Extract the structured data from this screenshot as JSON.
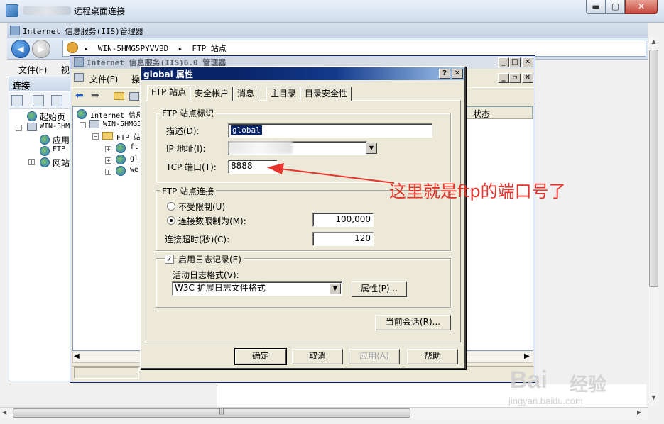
{
  "rdp": {
    "title": "远程桌面连接",
    "buttons": {
      "minimize": "▬",
      "maximize": "▢",
      "close": "✕"
    }
  },
  "iis7": {
    "title": "Internet 信息服务(IIS)管理器",
    "breadcrumb": "▸  WIN-5HMG5PYVVBD  ▸  FTP 站点",
    "menu": {
      "file": "文件(F)",
      "view": "视"
    },
    "connections": {
      "title": "连接",
      "tree": [
        {
          "label": "起始页"
        },
        {
          "label": "WIN-5HM"
        },
        {
          "label": "应用"
        },
        {
          "label": "FTP"
        },
        {
          "label": "网站"
        }
      ]
    }
  },
  "iis6": {
    "title": "Internet 信息服务(IIS)6.0 管理器",
    "menu": {
      "file": "文件(F)",
      "op": "操"
    },
    "tree": [
      {
        "label": "Internet 信息"
      },
      {
        "label": "WIN-5HMG5"
      },
      {
        "label": "FTP 站点"
      },
      {
        "label": "ft"
      },
      {
        "label": "gl"
      },
      {
        "label": "we"
      }
    ],
    "list_header": {
      "status": "状态"
    }
  },
  "dialog": {
    "title": "global 属性",
    "help_btn": "?",
    "close_btn": "✕",
    "tabs": [
      "FTP 站点",
      "安全帐户",
      "消息",
      "主目录",
      "目录安全性"
    ],
    "active_tab": "FTP 站点",
    "group_identity": {
      "label": "FTP 站点标识",
      "desc_label": "描述(D):",
      "desc_value": "global",
      "ip_label": "IP 地址(I):",
      "port_label": "TCP 端口(T):",
      "port_value": "8888"
    },
    "group_connection": {
      "label": "FTP 站点连接",
      "unlimited_label": "不受限制(U)",
      "limited_label": "连接数限制为(M):",
      "limited_selected": true,
      "limit_value": "100,000",
      "timeout_label": "连接超时(秒)(C):",
      "timeout_value": "120"
    },
    "group_logging": {
      "enable_label": "启用日志记录(E)",
      "enabled": true,
      "format_label": "活动日志格式(V):",
      "format_value": "W3C 扩展日志文件格式",
      "properties_button": "属性(P)..."
    },
    "current_sessions_button": "当前会话(R)...",
    "buttons": {
      "ok": "确定",
      "cancel": "取消",
      "apply": "应用(A)",
      "help": "帮助"
    }
  },
  "annotation": {
    "text": "这里就是ftp的端口号了",
    "color": "#e8332b"
  },
  "watermark": {
    "brand": "Bai",
    "brand2": "经验",
    "url": "jingyan.baidu.com"
  }
}
